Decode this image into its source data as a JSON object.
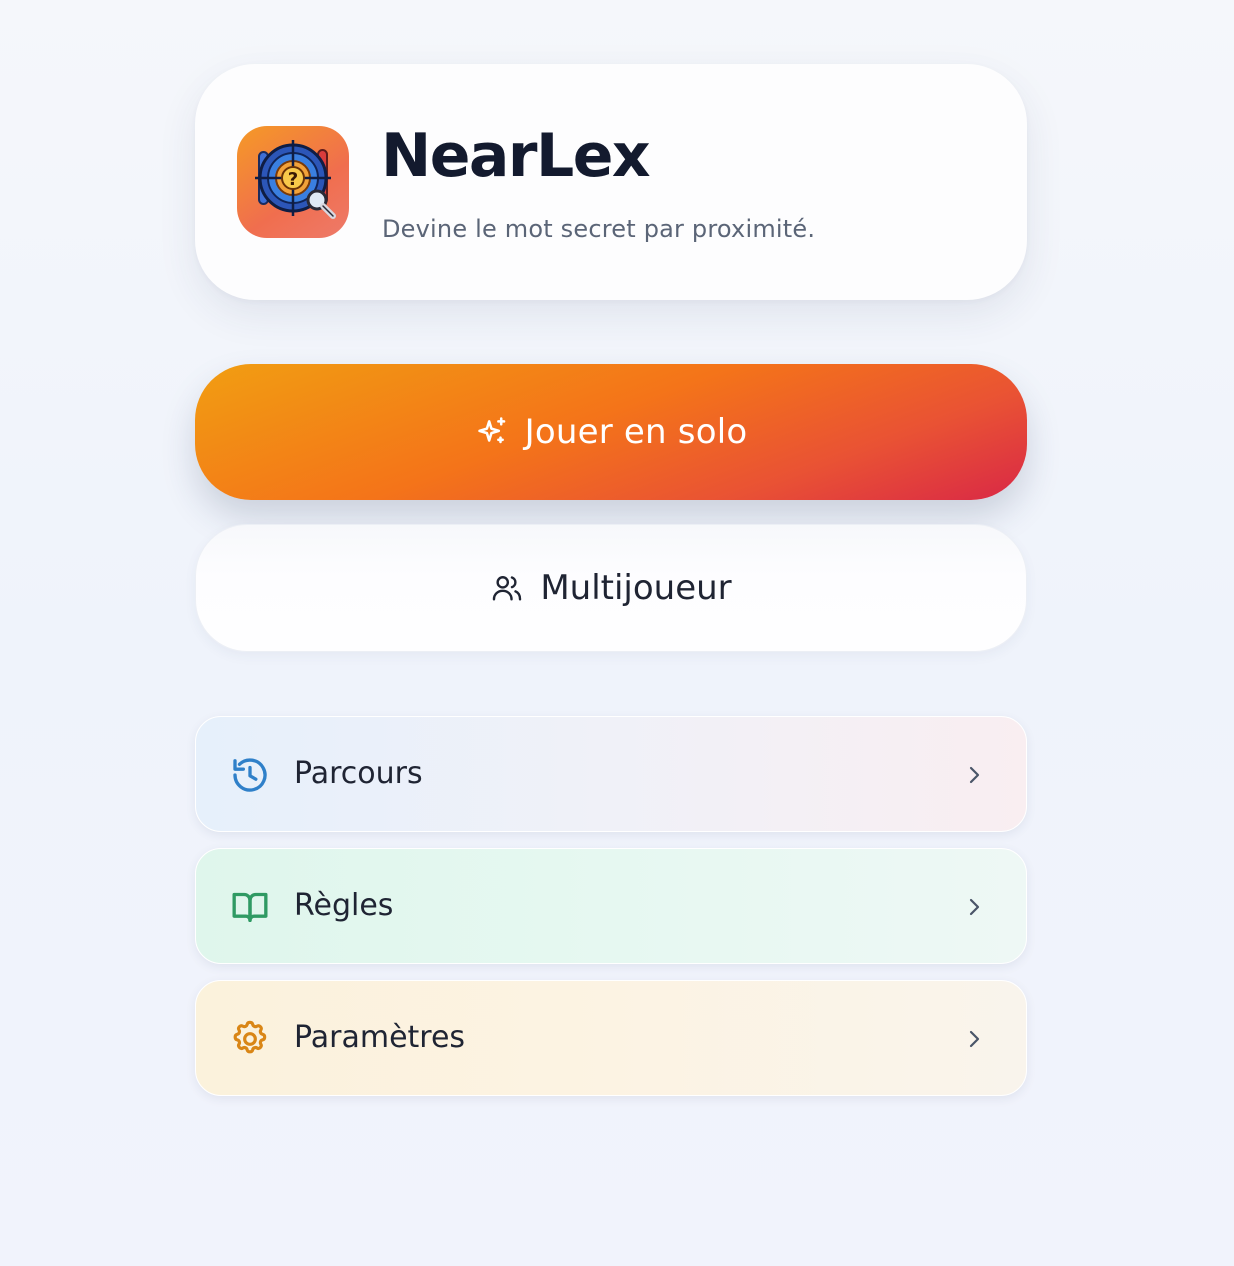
{
  "header": {
    "title": "NearLex",
    "subtitle": "Devine le mot secret par proximité.",
    "icon": "app-logo-target-magnifier-question"
  },
  "actions": {
    "solo": {
      "label": "Jouer en solo",
      "icon": "sparkles-icon"
    },
    "multiplayer": {
      "label": "Multijoueur",
      "icon": "users-icon"
    }
  },
  "menu": {
    "items": [
      {
        "label": "Parcours",
        "icon": "history-icon",
        "color": "#2f80c9"
      },
      {
        "label": "Règles",
        "icon": "book-icon",
        "color": "#2f9a63"
      },
      {
        "label": "Paramètres",
        "icon": "gear-icon",
        "color": "#d98616"
      }
    ],
    "chevron_icon": "chevron-right-icon"
  },
  "colors": {
    "accent_start": "#f19e12",
    "accent_end": "#d92846",
    "title": "#131a2e",
    "text_muted": "#5b6577"
  }
}
